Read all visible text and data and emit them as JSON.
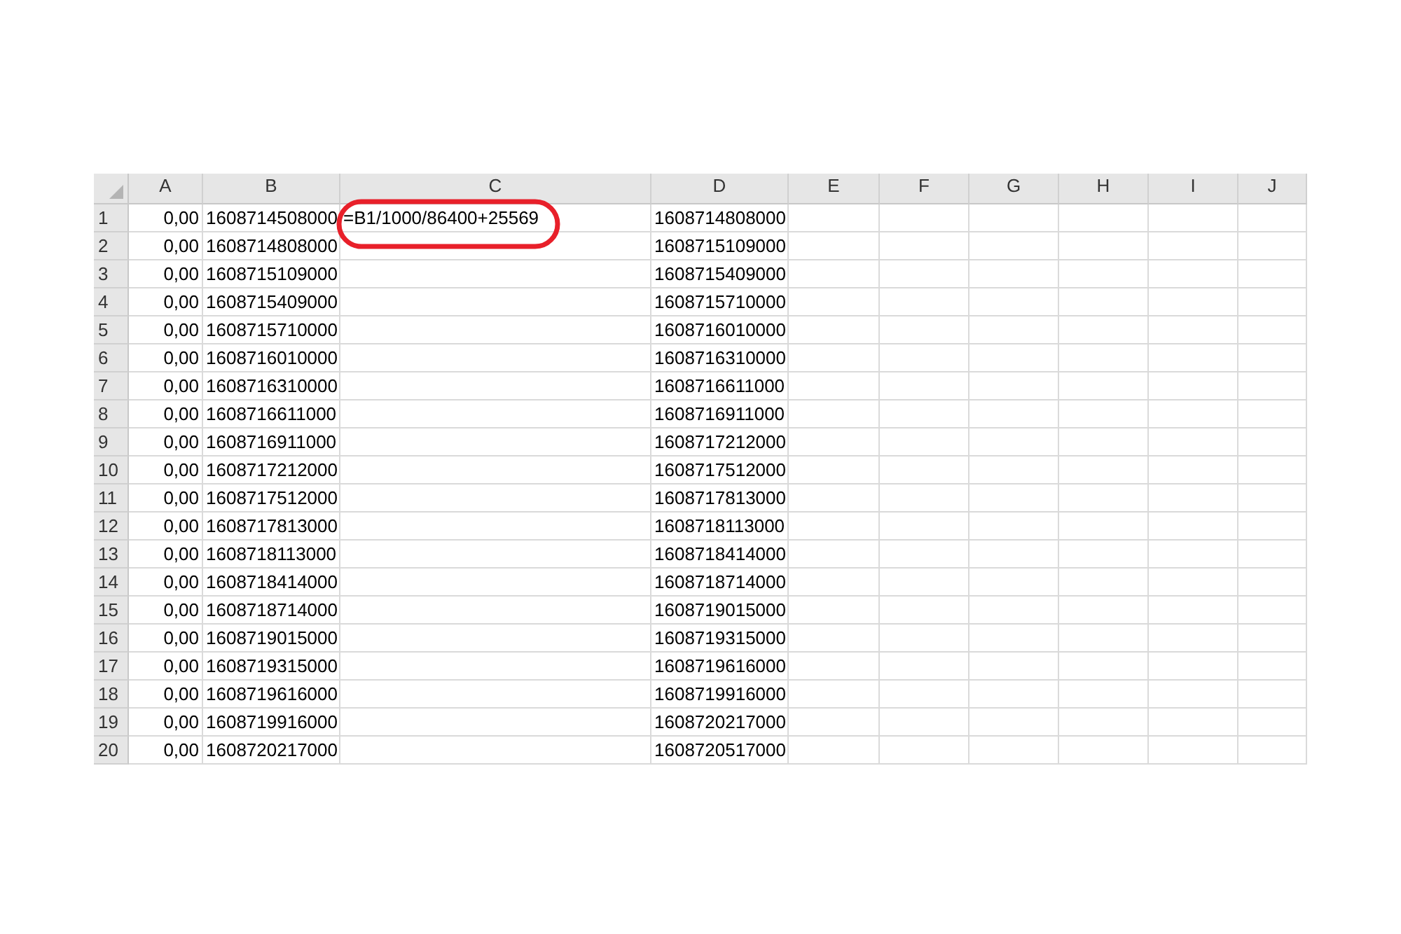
{
  "columns": [
    "A",
    "B",
    "C",
    "D",
    "E",
    "F",
    "G",
    "H",
    "I",
    "J"
  ],
  "rows": [
    {
      "row": "1",
      "a": "0,00",
      "b": "1608714508000",
      "c": "=B1/1000/86400+25569",
      "d": "1608714808000",
      "circled": true
    },
    {
      "row": "2",
      "a": "0,00",
      "b": "1608714808000",
      "d": "1608715109000",
      "circled": false
    },
    {
      "row": "3",
      "a": "0,00",
      "b": "1608715109000",
      "d": "1608715409000",
      "circled": false
    },
    {
      "row": "4",
      "a": "0,00",
      "b": "1608715409000",
      "d": "1608715710000",
      "circled": false
    },
    {
      "row": "5",
      "a": "0,00",
      "b": "1608715710000",
      "d": "1608716010000",
      "circled": false
    },
    {
      "row": "6",
      "a": "0,00",
      "b": "1608716010000",
      "d": "1608716310000",
      "circled": false
    },
    {
      "row": "7",
      "a": "0,00",
      "b": "1608716310000",
      "d": "1608716611000",
      "circled": false
    },
    {
      "row": "8",
      "a": "0,00",
      "b": "1608716611000",
      "d": "1608716911000",
      "circled": false
    },
    {
      "row": "9",
      "a": "0,00",
      "b": "1608716911000",
      "d": "1608717212000",
      "circled": false
    },
    {
      "row": "10",
      "a": "0,00",
      "b": "1608717212000",
      "d": "1608717512000",
      "circled": false
    },
    {
      "row": "11",
      "a": "0,00",
      "b": "1608717512000",
      "d": "1608717813000",
      "circled": false
    },
    {
      "row": "12",
      "a": "0,00",
      "b": "1608717813000",
      "d": "1608718113000",
      "circled": false
    },
    {
      "row": "13",
      "a": "0,00",
      "b": "1608718113000",
      "d": "1608718414000",
      "circled": false
    },
    {
      "row": "14",
      "a": "0,00",
      "b": "1608718414000",
      "d": "1608718714000",
      "circled": false
    },
    {
      "row": "15",
      "a": "0,00",
      "b": "1608718714000",
      "d": "1608719015000",
      "circled": false
    },
    {
      "row": "16",
      "a": "0,00",
      "b": "1608719015000",
      "d": "1608719315000",
      "circled": false
    },
    {
      "row": "17",
      "a": "0,00",
      "b": "1608719315000",
      "d": "1608719616000",
      "circled": false
    },
    {
      "row": "18",
      "a": "0,00",
      "b": "1608719616000",
      "d": "1608719916000",
      "circled": false
    },
    {
      "row": "19",
      "a": "0,00",
      "b": "1608719916000",
      "d": "1608720217000",
      "circled": false
    },
    {
      "row": "20",
      "a": "0,00",
      "b": "1608720217000",
      "d": "1608720517000",
      "circled": false
    }
  ]
}
